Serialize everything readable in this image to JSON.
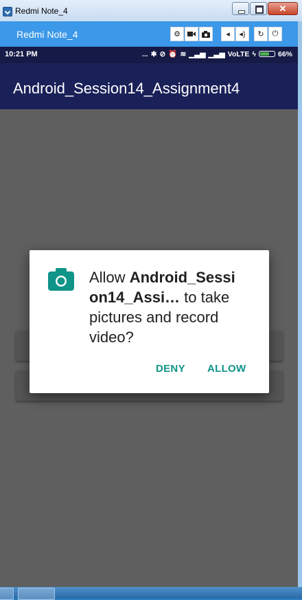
{
  "window": {
    "title": "Redmi Note_4"
  },
  "toolbar": {
    "device_name": "Redmi Note_4",
    "buttons": [
      "settings-icon",
      "video-record-icon",
      "camera-icon",
      "volume-down-icon",
      "volume-up-icon",
      "rotate-icon",
      "power-icon"
    ]
  },
  "status_bar": {
    "time": "10:21 PM",
    "dots": "...",
    "network": "VoLTE",
    "battery": "66%",
    "battery_level": 0.66
  },
  "app": {
    "title": "Android_Session14_Assignment4"
  },
  "dialog": {
    "msg_prefix": "Allow ",
    "app_name_line1": "Android_Sessi",
    "app_name_line2": "on14_Assi…",
    "msg_suffix": " to take pictures and record video?",
    "deny_label": "DENY",
    "allow_label": "ALLOW",
    "accent_color": "#0f9488"
  }
}
